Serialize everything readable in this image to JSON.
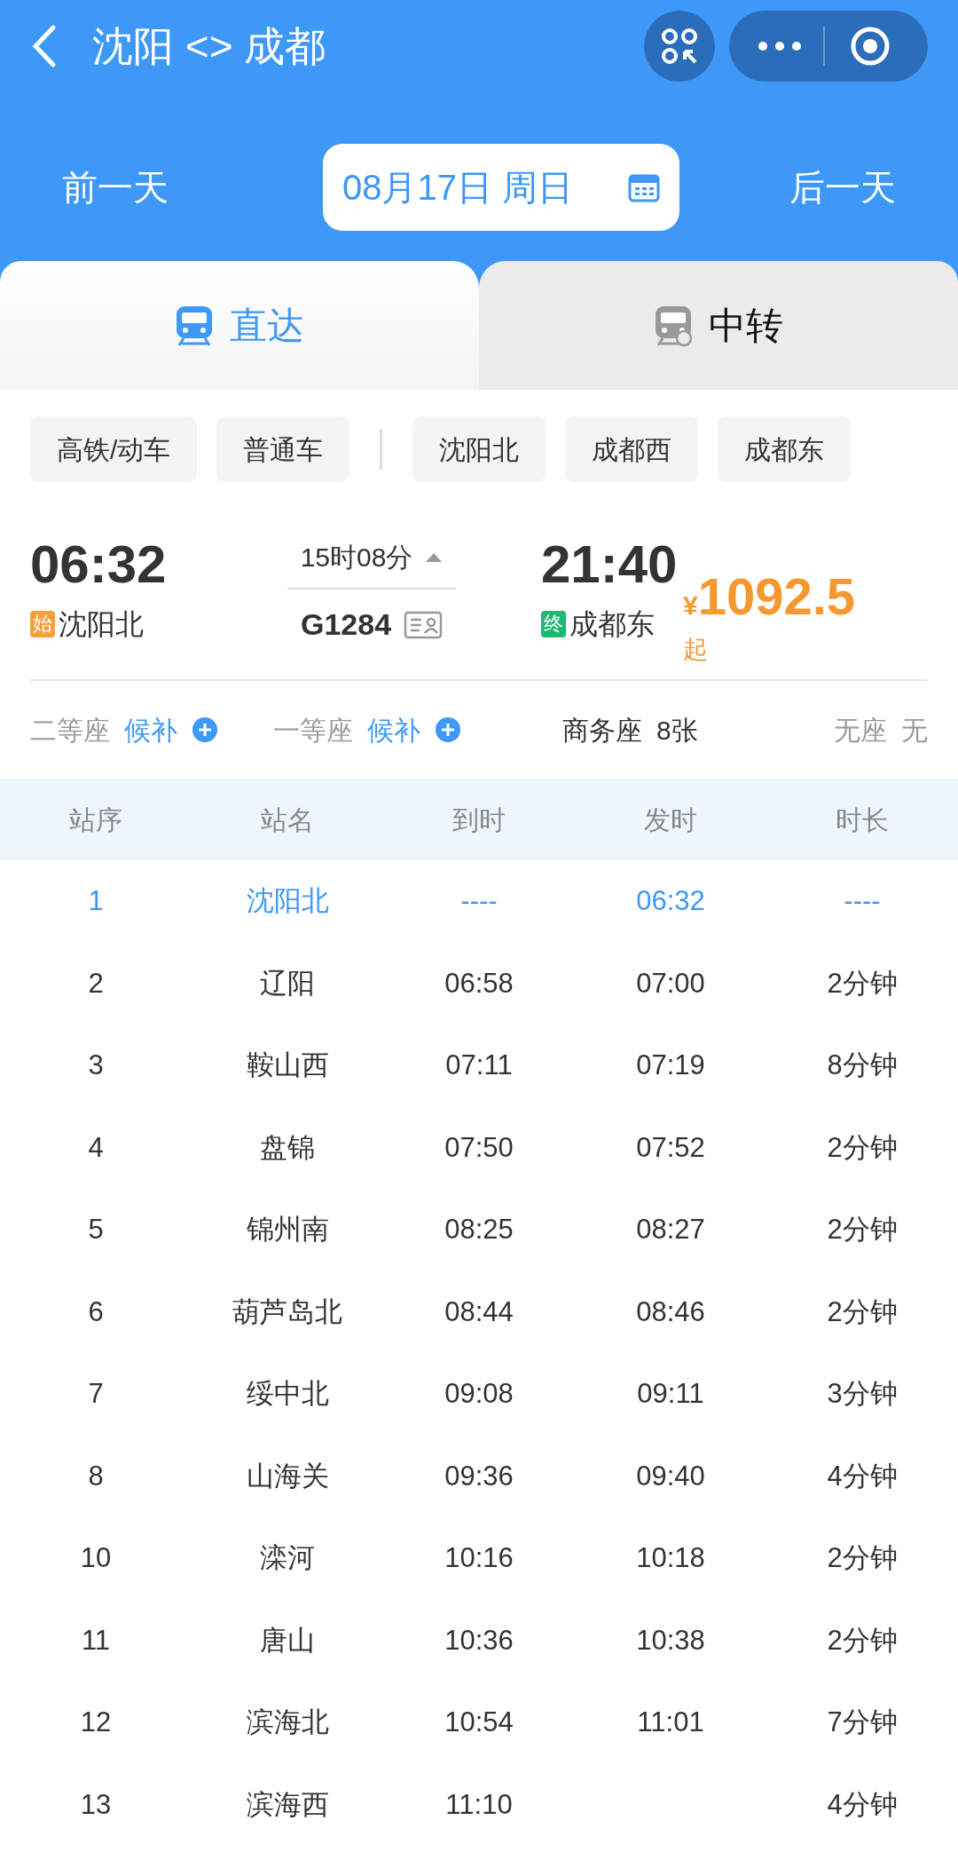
{
  "nav": {
    "title": "沈阳 <> 成都"
  },
  "date_bar": {
    "prev": "前一天",
    "date": "08月17日 周日",
    "next": "后一天"
  },
  "tabs": [
    {
      "label": "直达",
      "selected": true
    },
    {
      "label": "中转",
      "selected": false
    }
  ],
  "train_type_filters": [
    "高铁/动车",
    "普通车"
  ],
  "station_filters": [
    "沈阳北",
    "成都西",
    "成都东"
  ],
  "train": {
    "depart_time": "06:32",
    "depart_tag": "始",
    "depart_station": "沈阳北",
    "duration": "15时08分",
    "expanded": true,
    "number": "G1284",
    "arrive_time": "21:40",
    "arrive_tag": "终",
    "arrive_station": "成都东",
    "currency": "¥",
    "price": "1092.5",
    "price_suffix": "起"
  },
  "seats": [
    {
      "label": "二等座",
      "value": "候补",
      "kind": "waitlist"
    },
    {
      "label": "一等座",
      "value": "候补",
      "kind": "waitlist"
    },
    {
      "label": "商务座",
      "value": "8张",
      "kind": "count"
    },
    {
      "label": "无座",
      "value": "无",
      "kind": "none"
    }
  ],
  "table": {
    "columns": [
      "站序",
      "站名",
      "到时",
      "发时",
      "时长"
    ],
    "rows": [
      {
        "no": "1",
        "station": "沈阳北",
        "arrive": "----",
        "depart": "06:32",
        "stop": "----",
        "highlighted": true
      },
      {
        "no": "2",
        "station": "辽阳",
        "arrive": "06:58",
        "depart": "07:00",
        "stop": "2分钟",
        "highlighted": false
      },
      {
        "no": "3",
        "station": "鞍山西",
        "arrive": "07:11",
        "depart": "07:19",
        "stop": "8分钟",
        "highlighted": false
      },
      {
        "no": "4",
        "station": "盘锦",
        "arrive": "07:50",
        "depart": "07:52",
        "stop": "2分钟",
        "highlighted": false
      },
      {
        "no": "5",
        "station": "锦州南",
        "arrive": "08:25",
        "depart": "08:27",
        "stop": "2分钟",
        "highlighted": false
      },
      {
        "no": "6",
        "station": "葫芦岛北",
        "arrive": "08:44",
        "depart": "08:46",
        "stop": "2分钟",
        "highlighted": false
      },
      {
        "no": "7",
        "station": "绥中北",
        "arrive": "09:08",
        "depart": "09:11",
        "stop": "3分钟",
        "highlighted": false
      },
      {
        "no": "8",
        "station": "山海关",
        "arrive": "09:36",
        "depart": "09:40",
        "stop": "4分钟",
        "highlighted": false
      },
      {
        "no": "10",
        "station": "滦河",
        "arrive": "10:16",
        "depart": "10:18",
        "stop": "2分钟",
        "highlighted": false
      },
      {
        "no": "11",
        "station": "唐山",
        "arrive": "10:36",
        "depart": "10:38",
        "stop": "2分钟",
        "highlighted": false
      },
      {
        "no": "12",
        "station": "滨海北",
        "arrive": "10:54",
        "depart": "11:01",
        "stop": "7分钟",
        "highlighted": false
      },
      {
        "no": "13",
        "station": "滨海西",
        "arrive": "11:10",
        "stop": "4分钟",
        "highlighted": false
      }
    ]
  }
}
